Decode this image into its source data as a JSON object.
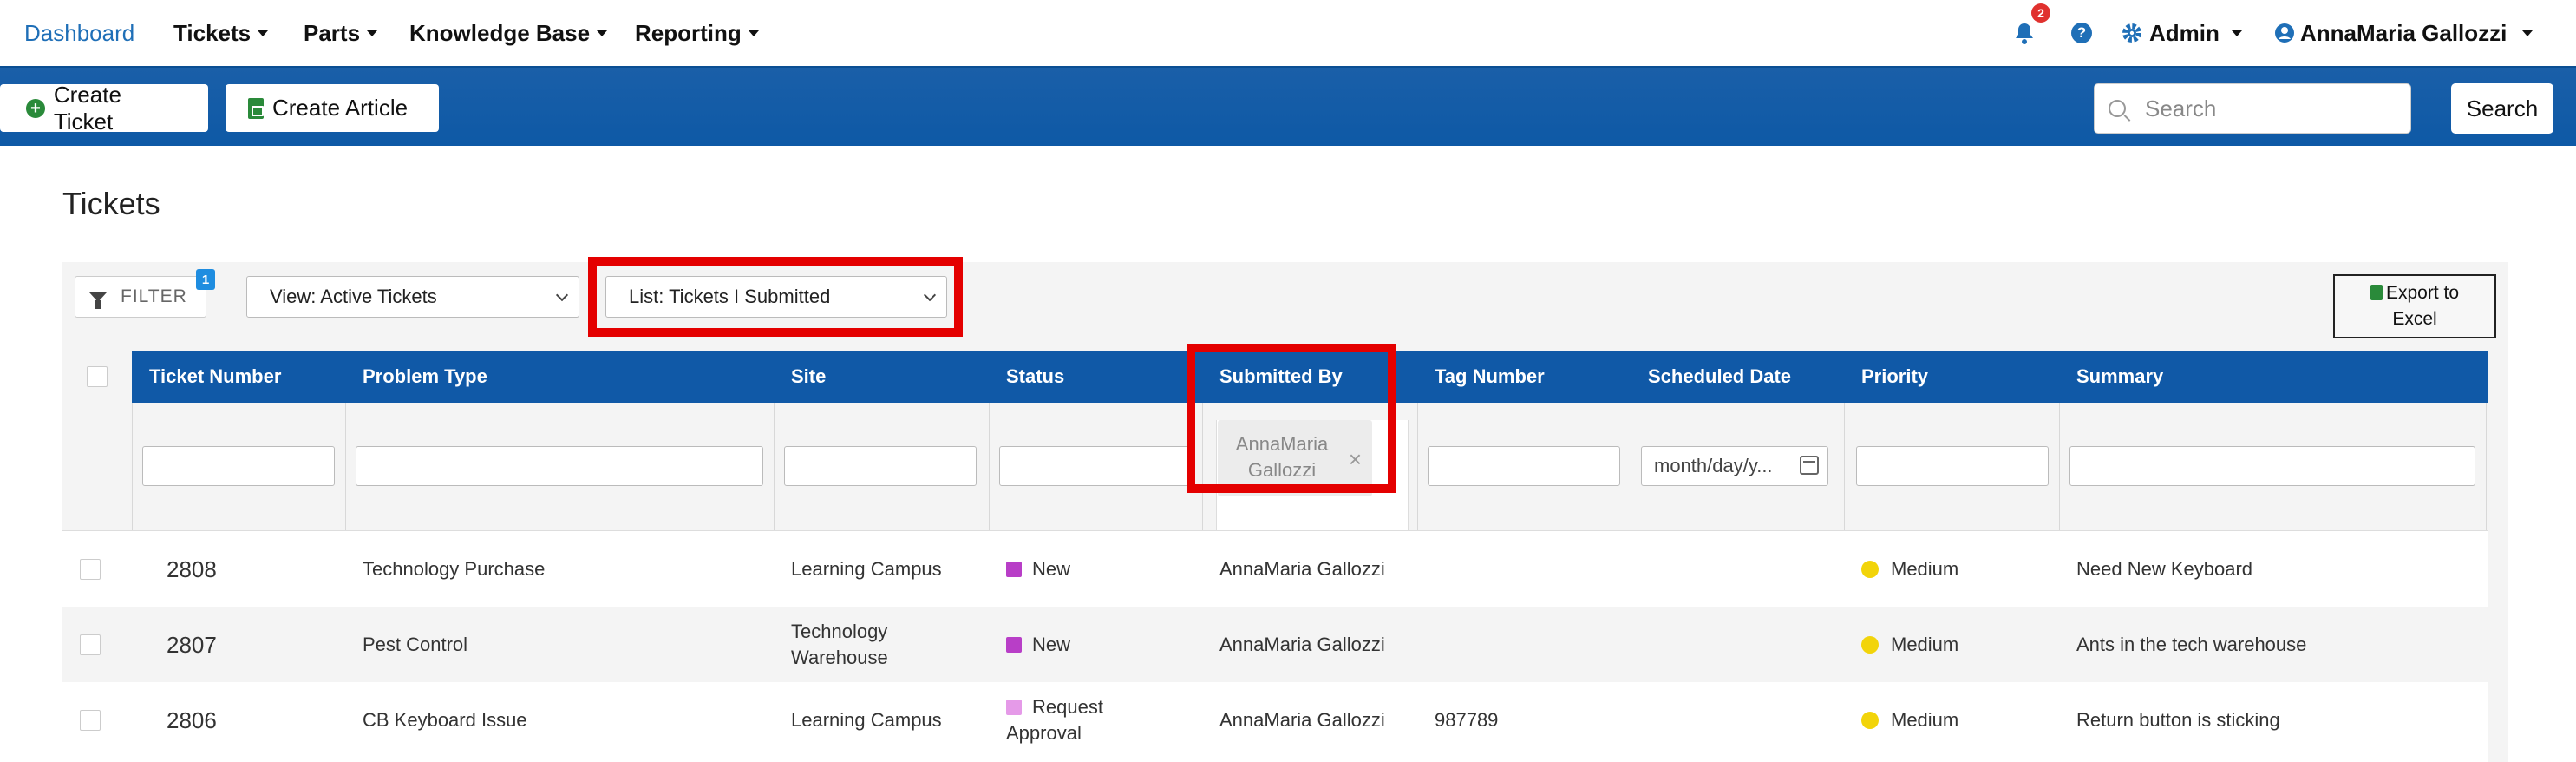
{
  "nav": {
    "brand": "Dashboard",
    "items": [
      "Tickets",
      "Parts",
      "Knowledge Base",
      "Reporting"
    ],
    "notifications_count": "2",
    "admin": "Admin",
    "user": "AnnaMaria Gallozzi"
  },
  "actionbar": {
    "create_ticket": "Create Ticket",
    "create_article": "Create Article",
    "search_placeholder": "Search",
    "search_button": "Search"
  },
  "page": {
    "title": "Tickets"
  },
  "toolbar": {
    "filter_label": "FILTER",
    "filter_count": "1",
    "view_select": "View: Active Tickets",
    "list_select": "List: Tickets I Submitted",
    "export_line1": "Export to",
    "export_line2": "Excel"
  },
  "table": {
    "columns": [
      "Ticket Number",
      "Problem Type",
      "Site",
      "Status",
      "Submitted By",
      "Tag Number",
      "Scheduled Date",
      "Priority",
      "Summary"
    ],
    "filters": {
      "submitted_by_line1": "AnnaMaria",
      "submitted_by_line2": "Gallozzi",
      "date_placeholder": "month/day/y..."
    },
    "rows": [
      {
        "ticket": "2808",
        "problem": "Technology Purchase",
        "site": "Learning Campus",
        "site2": "",
        "status": "New",
        "status2": "",
        "status_color": "#b83ec7",
        "submitted": "AnnaMaria Gallozzi",
        "tag": "",
        "date": "",
        "priority": "Medium",
        "priority_color": "#f2d40a",
        "summary": "Need New Keyboard"
      },
      {
        "ticket": "2807",
        "problem": "Pest Control",
        "site": "Technology",
        "site2": "Warehouse",
        "status": "New",
        "status2": "",
        "status_color": "#b83ec7",
        "submitted": "AnnaMaria Gallozzi",
        "tag": "",
        "date": "",
        "priority": "Medium",
        "priority_color": "#f2d40a",
        "summary": "Ants in the tech warehouse"
      },
      {
        "ticket": "2806",
        "problem": "CB Keyboard Issue",
        "site": "Learning Campus",
        "site2": "",
        "status": "Request",
        "status2": "Approval",
        "status_color": "#e59ae8",
        "submitted": "AnnaMaria Gallozzi",
        "tag": "987789",
        "date": "",
        "priority": "Medium",
        "priority_color": "#f2d40a",
        "summary": "Return button is sticking"
      }
    ]
  }
}
